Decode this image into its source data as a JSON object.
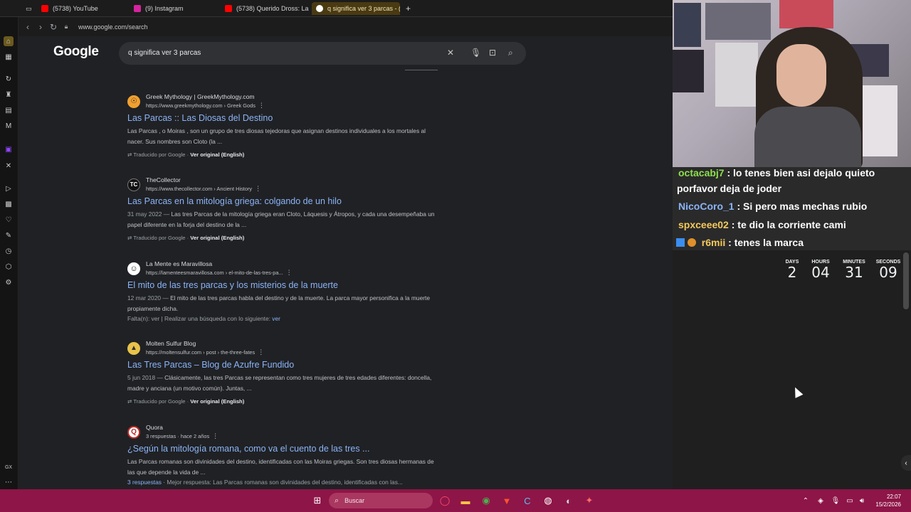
{
  "browser": {
    "tabs": [
      {
        "label": "(5738) YouTube",
        "color": "#ff0000"
      },
      {
        "label": "(9) Instagram",
        "color": "#d6249f"
      },
      {
        "label": "(5738) Querido Dross: La",
        "color": "#ff0000"
      },
      {
        "label": "q significa ver 3 parcas - (",
        "color": "#4285f4"
      }
    ],
    "new_tab": "+",
    "url": "www.google.com/search"
  },
  "google": {
    "logo": "Google",
    "query": "q significa ver 3 parcas"
  },
  "results": [
    {
      "logo": "☉",
      "site": "Greek Mythology | GreekMythology.com",
      "url": "https://www.greekmythology.com › Greek Gods",
      "title": "Las Parcas :: Las Diosas del Destino",
      "snippet": "Las Parcas , o Moiras , son un grupo de tres diosas tejedoras que asignan destinos individuales a los mortales al nacer. Sus nombres son Cloto (la ...",
      "translated_label": "Traducido por Google ·",
      "original_label": "Ver original (English)"
    },
    {
      "logo": "TC",
      "site": "TheCollector",
      "url": "https://www.thecollector.com › Ancient History",
      "title": "Las Parcas en la mitología griega: colgando de un hilo",
      "date": "31 may 2022 —",
      "snippet": "Las tres Parcas de la mitología griega eran Cloto, Láquesis y Átropos, y cada una desempeñaba un papel diferente en la forja del destino de la ...",
      "translated_label": "Traducido por Google ·",
      "original_label": "Ver original (English)"
    },
    {
      "logo": "☺",
      "site": "La Mente es Maravillosa",
      "url": "https://lamenteesmaravillosa.com › el-mito-de-las-tres-pa...",
      "title": "El mito de las tres parcas y los misterios de la muerte",
      "date": "12 mar 2020 —",
      "snippet": "El mito de las tres parcas habla del destino y de la muerte. La parca mayor personifica a la muerte propiamente dicha.",
      "missing": "Falta(n): ver | Realizar una búsqueda con lo siguiente:",
      "missing_link": "ver"
    },
    {
      "logo": "▲",
      "site": "Molten Sulfur Blog",
      "url": "https://moltensulfur.com › post › the-three-fates",
      "title": "Las Tres Parcas – Blog de Azufre Fundido",
      "date": "5 jun 2018 —",
      "snippet": "Clásicamente, las tres Parcas se representan como tres mujeres de tres edades diferentes: doncella, madre y anciana (un motivo común). Juntas, ...",
      "translated_label": "Traducido por Google ·",
      "original_label": "Ver original (English)"
    },
    {
      "logo": "Q",
      "site": "Quora",
      "url": "3 respuestas · hace 2 años",
      "title": "¿Según la mitología romana, como va el cuento de las tres ...",
      "snippet": "Las Parcas romanas son divinidades del destino, identificadas con las Moiras griegas. Son tres diosas hermanas de las que depende la vida de ...",
      "answers_link": "3 respuestas",
      "best_answer": "· Mejor respuesta: Las Parcas romanas son divinidades del destino, identificadas con las..."
    }
  ],
  "chat": [
    {
      "user": "octacabj7",
      "color": "#8be04e",
      "message": ": lo tenes bien asi dejalo quieto"
    },
    {
      "user": "",
      "color": "#ffffff",
      "message": "porfavor deja de joder"
    },
    {
      "user": "NicoCoro_1",
      "color": "#8ab4f8",
      "message": ": Si pero mas mechas rubio"
    },
    {
      "user": "spxceee02",
      "color": "#f4c95d",
      "message": ": te dio la corriente cami"
    },
    {
      "user": "r6mii",
      "color": "#f4c95d",
      "message": ": tenes la marca"
    }
  ],
  "countdown": {
    "days_label": "DAYS",
    "days": "2",
    "hours_label": "HOURS",
    "hours": "04",
    "minutes_label": "MINUTES",
    "minutes": "31",
    "seconds_label": "SECONDS",
    "seconds": "09"
  },
  "taskbar": {
    "search_placeholder": "Buscar",
    "time": "22:07",
    "date": "15/2/2026"
  },
  "sidebar_extra": "GX"
}
